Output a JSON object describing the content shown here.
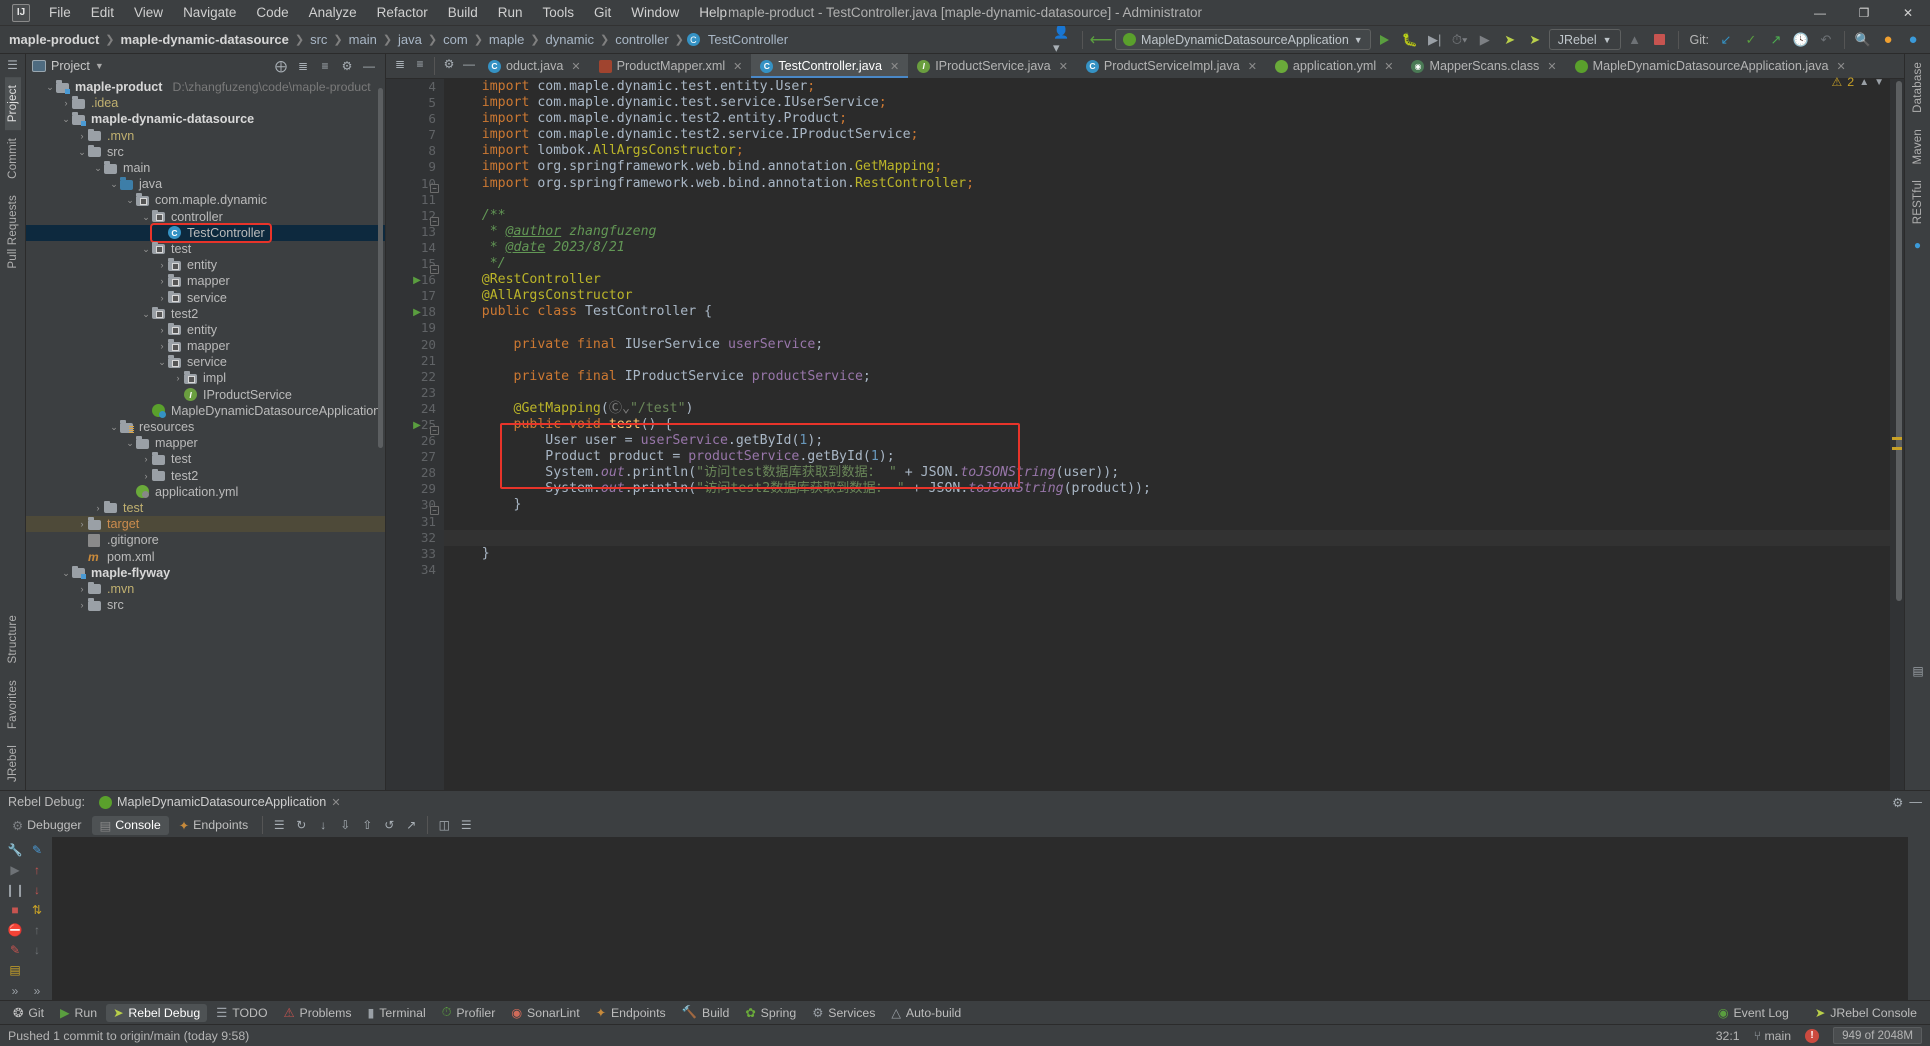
{
  "titlebar": {
    "logo": "IJ",
    "menus": [
      "File",
      "Edit",
      "View",
      "Navigate",
      "Code",
      "Analyze",
      "Refactor",
      "Build",
      "Run",
      "Tools",
      "Git",
      "Window",
      "Help"
    ],
    "window_title": "maple-product - TestController.java [maple-dynamic-datasource] - Administrator",
    "minimize": "—",
    "maximize": "❐",
    "close": "✕"
  },
  "navbar": {
    "breadcrumbs": [
      {
        "label": "maple-product",
        "bold": true
      },
      {
        "label": "maple-dynamic-datasource",
        "bold": true
      },
      {
        "label": "src",
        "bold": false
      },
      {
        "label": "main",
        "bold": false
      },
      {
        "label": "java",
        "bold": false
      },
      {
        "label": "com",
        "bold": false
      },
      {
        "label": "maple",
        "bold": false
      },
      {
        "label": "dynamic",
        "bold": false
      },
      {
        "label": "controller",
        "bold": false
      },
      {
        "label": "TestController",
        "bold": false,
        "icon": "class-icon"
      }
    ],
    "run_configuration": "MapleDynamicDatasourceApplication",
    "jrebel_label": "JRebel",
    "git_label": "Git:",
    "icons": [
      "user-avatar-icon",
      "back-arrow-icon",
      "run-icon",
      "debug-icon",
      "run-coverage-icon",
      "profile-icon",
      "rerun-icon",
      "jrebel-run-icon",
      "jrebel-debug-icon",
      "build-icon",
      "stop-icon",
      "git-update-icon",
      "git-commit-icon",
      "git-push-icon",
      "git-history-icon",
      "git-rollback-icon",
      "search-everywhere-icon",
      "notifications-icon",
      "ide-icon"
    ]
  },
  "left_strip": {
    "tabs": [
      "Project",
      "Commit",
      "Pull Requests"
    ],
    "bottom_tabs": [
      "Structure",
      "Favorites",
      "JRebel"
    ]
  },
  "right_strip": {
    "tabs": [
      "Database",
      "Maven",
      "RESTful",
      "Notifications"
    ]
  },
  "project_panel": {
    "title": "Project",
    "header_icons": [
      "locate-icon",
      "expand-all-icon",
      "collapse-all-icon",
      "settings-icon",
      "hide-icon"
    ],
    "tree": [
      {
        "indent": 0,
        "arrow": "v",
        "icon": "module-folder",
        "label": "maple-product",
        "bold": true,
        "path": "D:\\zhangfuzeng\\code\\maple-product"
      },
      {
        "indent": 1,
        "arrow": ">",
        "icon": "folder",
        "label": ".idea",
        "color": "yellowish"
      },
      {
        "indent": 1,
        "arrow": "v",
        "icon": "module-folder",
        "label": "maple-dynamic-datasource",
        "bold": true
      },
      {
        "indent": 2,
        "arrow": ">",
        "icon": "folder",
        "label": ".mvn",
        "color": "yellowish"
      },
      {
        "indent": 2,
        "arrow": "v",
        "icon": "folder",
        "label": "src"
      },
      {
        "indent": 3,
        "arrow": "v",
        "icon": "folder",
        "label": "main"
      },
      {
        "indent": 4,
        "arrow": "v",
        "icon": "source-folder",
        "label": "java"
      },
      {
        "indent": 5,
        "arrow": "v",
        "icon": "package",
        "label": "com.maple.dynamic"
      },
      {
        "indent": 6,
        "arrow": "v",
        "icon": "package",
        "label": "controller"
      },
      {
        "indent": 7,
        "arrow": "",
        "icon": "class",
        "label": "TestController",
        "selected": true,
        "highlight": true
      },
      {
        "indent": 6,
        "arrow": "v",
        "icon": "package",
        "label": "test"
      },
      {
        "indent": 7,
        "arrow": ">",
        "icon": "package",
        "label": "entity"
      },
      {
        "indent": 7,
        "arrow": ">",
        "icon": "package",
        "label": "mapper"
      },
      {
        "indent": 7,
        "arrow": ">",
        "icon": "package",
        "label": "service"
      },
      {
        "indent": 6,
        "arrow": "v",
        "icon": "package",
        "label": "test2"
      },
      {
        "indent": 7,
        "arrow": ">",
        "icon": "package",
        "label": "entity"
      },
      {
        "indent": 7,
        "arrow": ">",
        "icon": "package",
        "label": "mapper"
      },
      {
        "indent": 7,
        "arrow": "v",
        "icon": "package",
        "label": "service"
      },
      {
        "indent": 8,
        "arrow": ">",
        "icon": "package",
        "label": "impl"
      },
      {
        "indent": 8,
        "arrow": "",
        "icon": "interface",
        "label": "IProductService"
      },
      {
        "indent": 6,
        "arrow": "",
        "icon": "spring",
        "label": "MapleDynamicDatasourceApplication"
      },
      {
        "indent": 4,
        "arrow": "v",
        "icon": "resource-folder",
        "label": "resources"
      },
      {
        "indent": 5,
        "arrow": "v",
        "icon": "folder",
        "label": "mapper"
      },
      {
        "indent": 6,
        "arrow": ">",
        "icon": "folder",
        "label": "test"
      },
      {
        "indent": 6,
        "arrow": ">",
        "icon": "folder",
        "label": "test2"
      },
      {
        "indent": 5,
        "arrow": "",
        "icon": "yml",
        "label": "application.yml"
      },
      {
        "indent": 3,
        "arrow": ">",
        "icon": "folder",
        "label": "test",
        "color": "greenish"
      },
      {
        "indent": 2,
        "arrow": ">",
        "icon": "folder",
        "label": "target",
        "color": "orange",
        "selected_orange": true
      },
      {
        "indent": 2,
        "arrow": "",
        "icon": "gitignore",
        "label": ".gitignore"
      },
      {
        "indent": 2,
        "arrow": "",
        "icon": "maven",
        "label": "pom.xml"
      },
      {
        "indent": 1,
        "arrow": "v",
        "icon": "module-folder",
        "label": "maple-flyway",
        "bold": true
      },
      {
        "indent": 2,
        "arrow": ">",
        "icon": "folder",
        "label": ".mvn",
        "color": "yellowish"
      },
      {
        "indent": 2,
        "arrow": ">",
        "icon": "folder",
        "label": "src"
      }
    ]
  },
  "editor": {
    "tabs": [
      {
        "label": "oduct.java",
        "icon": "class-icon",
        "active": false,
        "truncated": true
      },
      {
        "label": "ProductMapper.xml",
        "icon": "xml-icon",
        "active": false
      },
      {
        "label": "TestController.java",
        "icon": "class-icon",
        "active": true
      },
      {
        "label": "IProductService.java",
        "icon": "interface-icon",
        "active": false
      },
      {
        "label": "ProductServiceImpl.java",
        "icon": "class-icon",
        "active": false
      },
      {
        "label": "application.yml",
        "icon": "yml-icon",
        "active": false
      },
      {
        "label": "MapperScans.class",
        "icon": "compiled-class-icon",
        "active": false
      },
      {
        "label": "MapleDynamicDatasourceApplication.java",
        "icon": "spring-icon",
        "active": false
      }
    ],
    "warning_count": "2",
    "first_line_number": 4,
    "lines": [
      {
        "n": 4,
        "html": "    <span class=\"k\">import</span> com.maple.dynamic.test.entity.User<span class=\"k\">;</span>"
      },
      {
        "n": 5,
        "html": "    <span class=\"k\">import</span> com.maple.dynamic.test.service.<span class=\"typ\">IUserService</span><span class=\"k\">;</span>"
      },
      {
        "n": 6,
        "html": "    <span class=\"k\">import</span> com.maple.dynamic.test2.entity.Product<span class=\"k\">;</span>"
      },
      {
        "n": 7,
        "html": "    <span class=\"k\">import</span> com.maple.dynamic.test2.service.<span class=\"typ\">IProductService</span><span class=\"k\">;</span>"
      },
      {
        "n": 8,
        "html": "    <span class=\"k\">import</span> lombok.<span class=\"an\">AllArgsConstructor</span><span class=\"k\">;</span>"
      },
      {
        "n": 9,
        "html": "    <span class=\"k\">import</span> org.springframework.web.bind.annotation.<span class=\"an\">GetMapping</span><span class=\"k\">;</span>"
      },
      {
        "n": 10,
        "html": "    <span class=\"k\">import</span> org.springframework.web.bind.annotation.<span class=\"an\">RestController</span><span class=\"k\">;</span>"
      },
      {
        "n": 11,
        "html": ""
      },
      {
        "n": 12,
        "html": "    <span class=\"c\">/**</span>"
      },
      {
        "n": 13,
        "html": "     <span class=\"c\">* </span><span class=\"doctag\">@author</span><span class=\"c\"> zhangfuzeng</span>"
      },
      {
        "n": 14,
        "html": "     <span class=\"c\">* </span><span class=\"doctag\">@date</span><span class=\"c\"> 2023/8/21</span>"
      },
      {
        "n": 15,
        "html": "     <span class=\"c\">*/</span>"
      },
      {
        "n": 16,
        "html": "    <span class=\"an\">@RestController</span>"
      },
      {
        "n": 17,
        "html": "    <span class=\"an\">@AllArgsConstructor</span>"
      },
      {
        "n": 18,
        "html": "    <span class=\"k\">public class</span> <span class=\"typ\">TestController</span> {"
      },
      {
        "n": 19,
        "html": ""
      },
      {
        "n": 20,
        "html": "        <span class=\"k\">private final</span> <span class=\"typ\">IUserService</span> <span class=\"fld2\">userService</span>;"
      },
      {
        "n": 21,
        "html": ""
      },
      {
        "n": 22,
        "html": "        <span class=\"k\">private final</span> <span class=\"typ\">IProductService</span> <span class=\"fld2\">productService</span>;"
      },
      {
        "n": 23,
        "html": ""
      },
      {
        "n": 24,
        "html": "        <span class=\"an\">@GetMapping</span>(<span class=\"cm\">Ⓒ⌄</span><span class=\"s\">\"/test\"</span>)"
      },
      {
        "n": 25,
        "html": "        <span class=\"k\">public void</span> <span class=\"mth\">test</span>() {"
      },
      {
        "n": 26,
        "html": "            <span class=\"typ\">User</span> user = <span class=\"fld2\">userService</span>.getById(<span class=\"num\">1</span>);"
      },
      {
        "n": 27,
        "html": "            <span class=\"typ\">Product</span> product = <span class=\"fld2\">productService</span>.getById(<span class=\"num\">1</span>);"
      },
      {
        "n": 28,
        "html": "            <span class=\"typ\">System</span>.<span class=\"st\">out</span>.println(<span class=\"s\">\"访问test数据库获取到数据： \"</span> + <span class=\"typ\">JSON</span>.<span class=\"st\">toJSONString</span>(user));"
      },
      {
        "n": 29,
        "html": "            <span class=\"typ\">System</span>.<span class=\"st\">out</span>.println(<span class=\"s\">\"访问test2数据库获取到数据： \"</span> + <span class=\"typ\">JSON</span>.<span class=\"st\">toJSONString</span>(product));"
      },
      {
        "n": 30,
        "html": "        }"
      },
      {
        "n": 31,
        "html": ""
      },
      {
        "n": 32,
        "html": "",
        "current": true
      },
      {
        "n": 33,
        "html": "    }"
      },
      {
        "n": 34,
        "html": ""
      }
    ]
  },
  "rebel_panel": {
    "title": "Rebel Debug:",
    "session_tab": "MapleDynamicDatasourceApplication",
    "tabs": [
      {
        "label": "Debugger",
        "active": false,
        "icon": "debugger-icon"
      },
      {
        "label": "Console",
        "active": true,
        "icon": "console-icon"
      },
      {
        "label": "Endpoints",
        "active": false,
        "icon": "endpoints-icon"
      }
    ],
    "toolbar_icons": [
      "list-icon",
      "rerun-icon",
      "download-icon",
      "export-icon",
      "import-icon",
      "restore-icon",
      "wrap-icon",
      "soft-wrap-icon"
    ],
    "side_icons": [
      "settings-icon",
      "wrench-icon",
      "pencil-icon",
      "resume-icon",
      "step-up-icon",
      "pause-icon",
      "step-down-icon",
      "stop-icon",
      "sort-icon",
      "mute-icon",
      "up-icon",
      "down-icon",
      "camera-icon",
      "filter-icon",
      "layout-icon"
    ],
    "console_output": ""
  },
  "bottom_toolbar": {
    "items": [
      {
        "label": "Git",
        "icon": "git-icon",
        "active": false
      },
      {
        "label": "Run",
        "icon": "run-icon",
        "active": false
      },
      {
        "label": "Rebel Debug",
        "icon": "jrebel-icon",
        "active": true
      },
      {
        "label": "TODO",
        "icon": "todo-icon",
        "active": false
      },
      {
        "label": "Problems",
        "icon": "problems-icon",
        "active": false
      },
      {
        "label": "Terminal",
        "icon": "terminal-icon",
        "active": false
      },
      {
        "label": "Profiler",
        "icon": "profiler-icon",
        "active": false
      },
      {
        "label": "SonarLint",
        "icon": "sonarlint-icon",
        "active": false
      },
      {
        "label": "Endpoints",
        "icon": "endpoints-icon",
        "active": false
      },
      {
        "label": "Build",
        "icon": "build-icon",
        "active": false
      },
      {
        "label": "Spring",
        "icon": "spring-icon",
        "active": false
      },
      {
        "label": "Services",
        "icon": "services-icon",
        "active": false
      },
      {
        "label": "Auto-build",
        "icon": "autobuild-icon",
        "active": false
      }
    ],
    "right_items": [
      {
        "label": "Event Log",
        "icon": "event-log-icon"
      },
      {
        "label": "JRebel Console",
        "icon": "jrebel-console-icon"
      }
    ]
  },
  "statusbar": {
    "message": "Pushed 1 commit to origin/main (today 9:58)",
    "caret": "32:1",
    "branch": "main",
    "branch_icon": "git-branch-icon",
    "memory": "949 of 2048M",
    "warn_icon": "error-icon"
  }
}
